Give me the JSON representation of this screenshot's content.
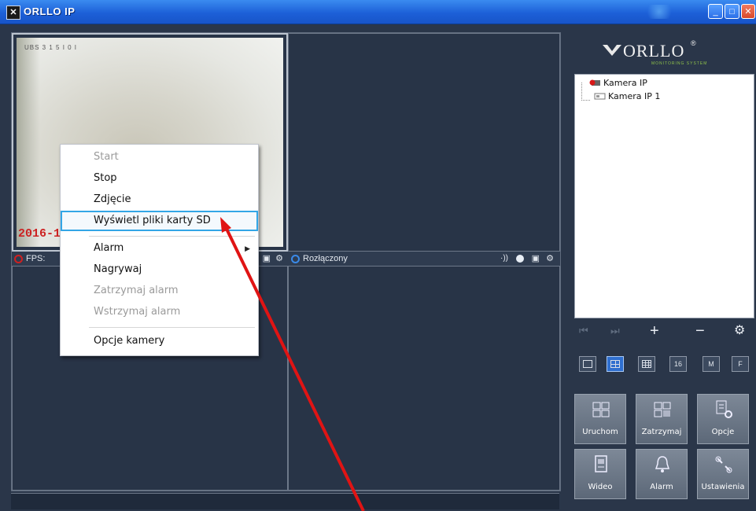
{
  "window": {
    "title": "ORLLO IP",
    "minimize_glyph": "_",
    "maximize_glyph": "□",
    "close_glyph": "✕"
  },
  "video": {
    "osd_top_text": "UBS 3  1 5 I 0 I",
    "osd_date": "2016-1",
    "cells": [
      {
        "status_icon": "fps-icon",
        "status_text": "FPS:"
      },
      {
        "status_icon": "power-icon",
        "status_text": "Rozłączony"
      }
    ]
  },
  "context_menu": {
    "items": [
      {
        "label": "Start",
        "enabled": false
      },
      {
        "label": "Stop",
        "enabled": true
      },
      {
        "label": "Zdjęcie",
        "enabled": true
      },
      {
        "label": "Wyświetl pliki karty SD",
        "enabled": true,
        "highlighted": true
      },
      {
        "label": "Alarm",
        "enabled": true,
        "submenu": true
      },
      {
        "label": "Nagrywaj",
        "enabled": true
      },
      {
        "label": "Zatrzymaj alarm",
        "enabled": false
      },
      {
        "label": "Wstrzymaj alarm",
        "enabled": false
      },
      {
        "label": "Opcje kamery",
        "enabled": true
      }
    ]
  },
  "sidebar": {
    "logo_text": "ORLLO",
    "logo_reg": "®",
    "logo_subtitle": "MONITORING SYSTEM",
    "tree": {
      "root": "Kamera IP",
      "child": "Kamera IP 1"
    },
    "nav": {
      "first": "⏮",
      "last": "⏭",
      "add": "+",
      "remove": "−",
      "settings": "⚙"
    },
    "layouts": [
      "1",
      "4",
      "9",
      "16",
      "M",
      "F"
    ],
    "buttons": [
      {
        "label": "Uruchom",
        "icon": "play-grid-icon"
      },
      {
        "label": "Zatrzymaj",
        "icon": "stop-grid-icon"
      },
      {
        "label": "Opcje",
        "icon": "options-icon"
      },
      {
        "label": "Wideo",
        "icon": "video-file-icon"
      },
      {
        "label": "Alarm",
        "icon": "bell-icon"
      },
      {
        "label": "Ustawienia",
        "icon": "wrench-icon"
      }
    ]
  },
  "colors": {
    "titlebar": "#1d60d8",
    "background": "#2a3649",
    "menu_highlight_border": "#33a6e6",
    "annotation_arrow": "#e01414",
    "osd_date": "#cc2222"
  }
}
